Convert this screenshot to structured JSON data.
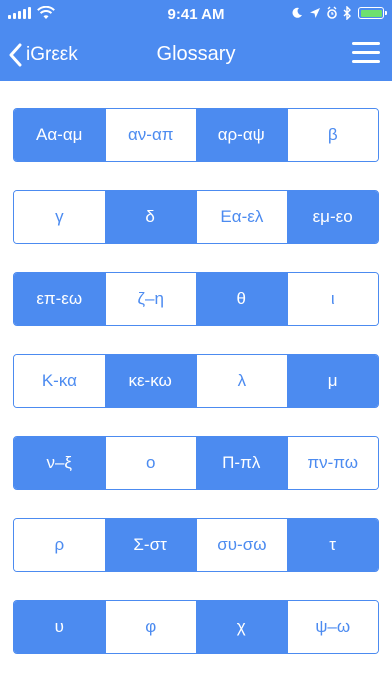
{
  "status": {
    "time": "9:41 AM"
  },
  "nav": {
    "back_label": "iGrεεk",
    "title": "Glossary"
  },
  "colors": {
    "accent": "#4c8bf0",
    "background": "#ffffff"
  },
  "glossary": {
    "rows": [
      {
        "cells": [
          {
            "label": "Αα-αμ",
            "filled": true
          },
          {
            "label": "αν-απ",
            "filled": false
          },
          {
            "label": "αρ-αψ",
            "filled": true
          },
          {
            "label": "β",
            "filled": false
          }
        ]
      },
      {
        "cells": [
          {
            "label": "γ",
            "filled": false
          },
          {
            "label": "δ",
            "filled": true
          },
          {
            "label": "Εα-ελ",
            "filled": false
          },
          {
            "label": "εμ-εο",
            "filled": true
          }
        ]
      },
      {
        "cells": [
          {
            "label": "επ-εω",
            "filled": true
          },
          {
            "label": "ζ–η",
            "filled": false
          },
          {
            "label": "θ",
            "filled": true
          },
          {
            "label": "ι",
            "filled": false
          }
        ]
      },
      {
        "cells": [
          {
            "label": "Κ-κα",
            "filled": false
          },
          {
            "label": "κε-κω",
            "filled": true
          },
          {
            "label": "λ",
            "filled": false
          },
          {
            "label": "μ",
            "filled": true
          }
        ]
      },
      {
        "cells": [
          {
            "label": "ν–ξ",
            "filled": true
          },
          {
            "label": "ο",
            "filled": false
          },
          {
            "label": "Π-πλ",
            "filled": true
          },
          {
            "label": "πν-πω",
            "filled": false
          }
        ]
      },
      {
        "cells": [
          {
            "label": "ρ",
            "filled": false
          },
          {
            "label": "Σ-στ",
            "filled": true
          },
          {
            "label": "συ-σω",
            "filled": false
          },
          {
            "label": "τ",
            "filled": true
          }
        ]
      },
      {
        "cells": [
          {
            "label": "υ",
            "filled": true
          },
          {
            "label": "φ",
            "filled": false
          },
          {
            "label": "χ",
            "filled": true
          },
          {
            "label": "ψ–ω",
            "filled": false
          }
        ]
      }
    ]
  }
}
